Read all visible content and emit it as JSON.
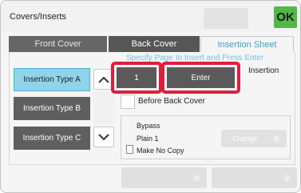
{
  "window": {
    "title": "Covers/Inserts",
    "ok_label": "OK"
  },
  "tabs": [
    {
      "label": "Front Cover",
      "state": "inactive"
    },
    {
      "label": "Back Cover",
      "state": "inactive"
    },
    {
      "label": "Insertion Sheet",
      "state": "active"
    }
  ],
  "hint": "Specify Page to Insert and Press Enter",
  "insertion_types": [
    {
      "label": "Insertion Type A",
      "selected": true
    },
    {
      "label": "Insertion Type B",
      "selected": false
    },
    {
      "label": "Insertion Type C",
      "selected": false
    }
  ],
  "page_input": {
    "value": "1"
  },
  "enter_label": "Enter",
  "insertion_label": "Insertion",
  "before_back_cover": {
    "label": "Before Back Cover",
    "checked": false
  },
  "tray": {
    "source": "Bypass",
    "paper": "Plain 1",
    "copy": "Make No Copy"
  },
  "change_label": "Change",
  "colors": {
    "accent": "#51b846",
    "highlight": "#de1f3c",
    "selected": "#8fd4ea",
    "tab_active_text": "#3aa4c3"
  }
}
